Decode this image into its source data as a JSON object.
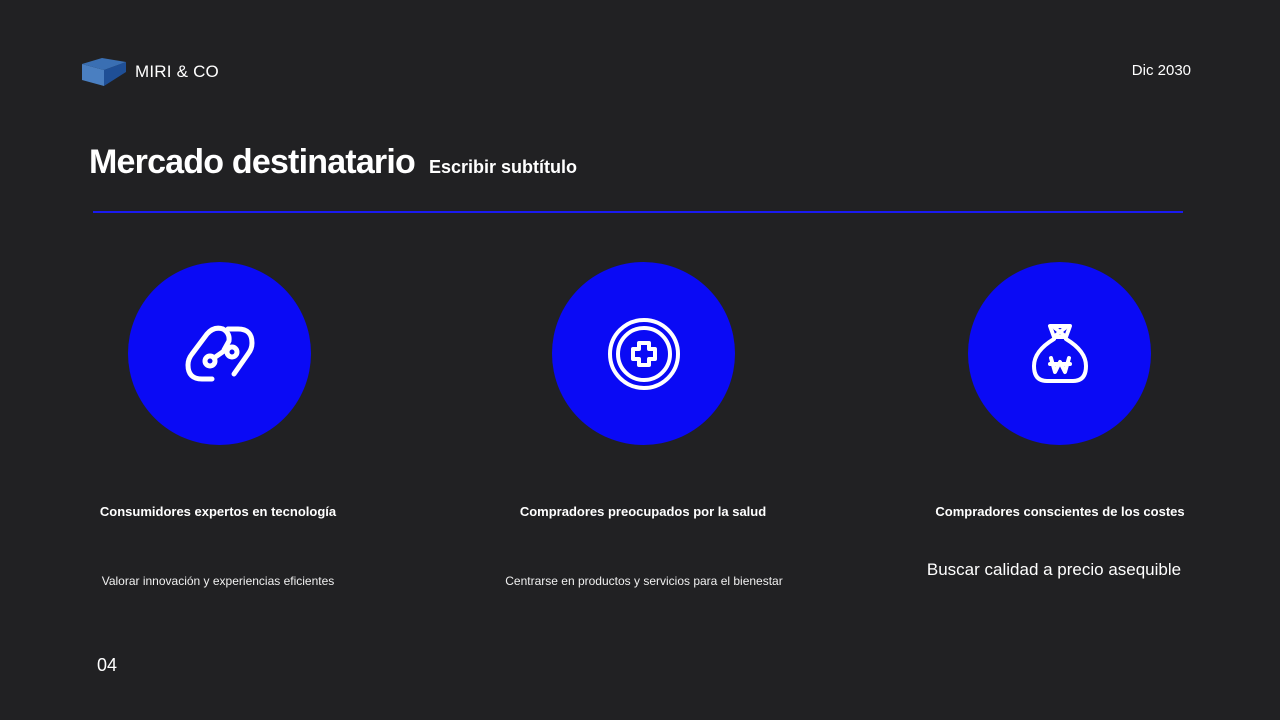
{
  "header": {
    "brand": "MIRI & CO",
    "date": "Dic 2030"
  },
  "slide": {
    "title": "Mercado destinatario",
    "subtitle": "Escribir subtítulo",
    "page_number": "04"
  },
  "accent_color": "#0a0af5",
  "background_color": "#212123",
  "cards": [
    {
      "icon": "link-icon",
      "title": "Consumidores expertos en tecnología",
      "description": "Valorar innovación y experiencias eficientes"
    },
    {
      "icon": "health-plus-icon",
      "title": "Compradores preocupados por la salud",
      "description": "Centrarse en productos y servicios para el bienestar"
    },
    {
      "icon": "money-bag-icon",
      "title": "Compradores conscientes de los costes",
      "description": "Buscar calidad a precio asequible"
    }
  ]
}
